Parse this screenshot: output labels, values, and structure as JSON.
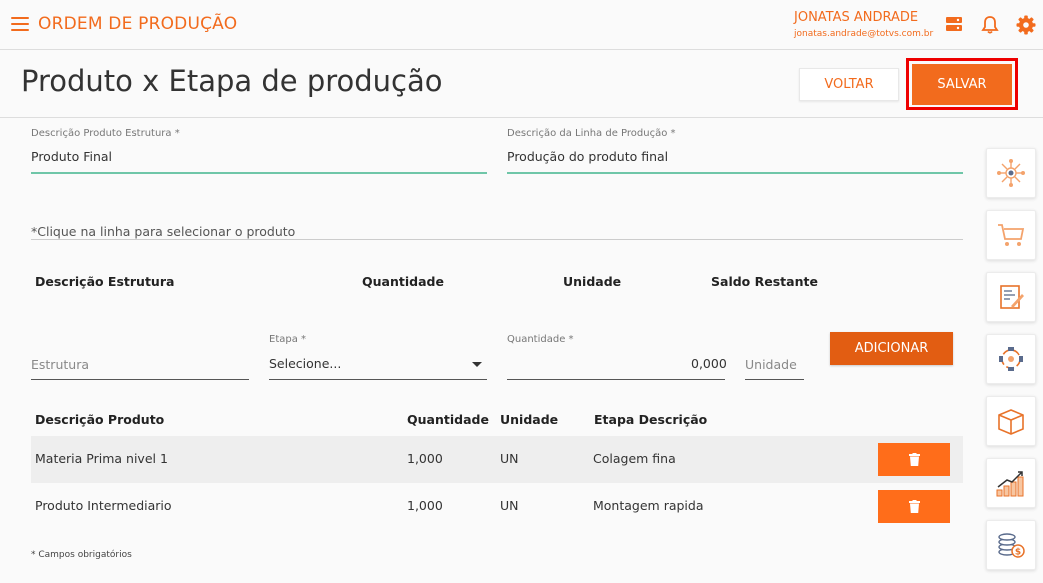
{
  "header": {
    "app_title": "ORDEM DE PRODUÇÃO",
    "user_name": "JONATAS ANDRADE",
    "user_email": "jonatas.andrade@totvs.com.br",
    "icons": [
      "menu-icon",
      "server-icon",
      "bell-icon",
      "gear-icon"
    ]
  },
  "page": {
    "title": "Produto x Etapa de produção",
    "back_label": "VOLTAR",
    "save_label": "SALVAR"
  },
  "form": {
    "structure_label": "Descrição Produto Estrutura *",
    "structure_value": "Produto Final",
    "line_label": "Descrição da Linha de Produção *",
    "line_value": "Produção do produto final",
    "hint": "*Clique na linha para selecionar o produto"
  },
  "structure_table": {
    "headers": [
      "Descrição Estrutura",
      "Quantidade",
      "Unidade",
      "Saldo Restante"
    ]
  },
  "add_form": {
    "structure_placeholder": "Estrutura",
    "stage_label": "Etapa *",
    "stage_value": "Selecione...",
    "quantity_label": "Quantidade *",
    "quantity_value": "0,000",
    "unit_placeholder": "Unidade",
    "add_label": "ADICIONAR"
  },
  "products_table": {
    "headers": [
      "Descrição Produto",
      "Quantidade",
      "Unidade",
      "Etapa Descrição"
    ],
    "rows": [
      {
        "product": "Materia Prima nivel 1",
        "quantity": "1,000",
        "unit": "UN",
        "stage": "Colagem fina"
      },
      {
        "product": "Produto Intermediario",
        "quantity": "1,000",
        "unit": "UN",
        "stage": "Montagem rapida"
      }
    ]
  },
  "footnote": "* Campos obrigatórios",
  "sidebar": {
    "icons": [
      "network-icon",
      "cart-icon",
      "document-icon",
      "workflow-icon",
      "box-icon",
      "growth-chart-icon",
      "coins-icon"
    ]
  },
  "colors": {
    "accent": "#f26b1d",
    "highlight": "#ee0000",
    "input_focus": "#6fc6a8",
    "delete_button": "#ff6d1a"
  }
}
